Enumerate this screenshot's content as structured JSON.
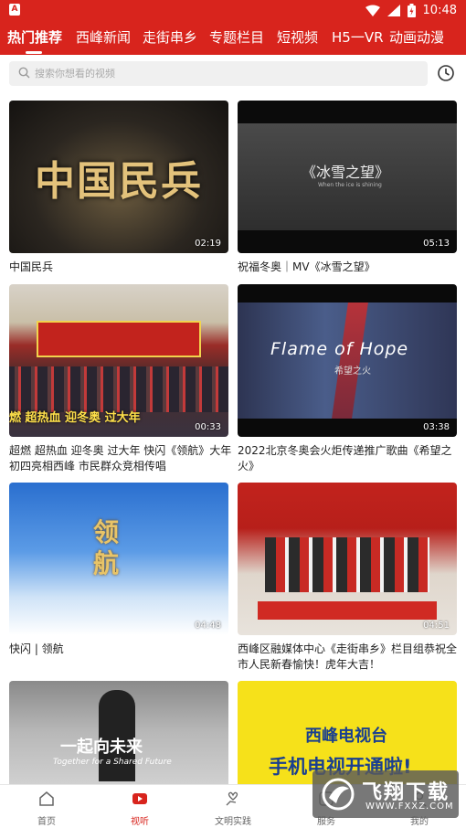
{
  "status": {
    "app_badge": "A",
    "time": "10:48"
  },
  "tabs": [
    {
      "label": "热门推荐",
      "active": true
    },
    {
      "label": "西峰新闻"
    },
    {
      "label": "走街串乡"
    },
    {
      "label": "专题栏目"
    },
    {
      "label": "短视频"
    },
    {
      "label": "H5一VR"
    },
    {
      "label": "动画动漫"
    }
  ],
  "search": {
    "placeholder": "搜索你想看的视频"
  },
  "thumb_text": {
    "v1_big": "中国民兵",
    "v2_title": "《冰雪之望》",
    "v2_sub": "When the ice is shining",
    "v3_banner": "燃 超热血 迎冬奥 过大年",
    "v4_title": "Flame of Hope",
    "v4_sub": "希望之火",
    "v5_title": "领航",
    "v7_cn": "一起向未来",
    "v7_en": "Together for a Shared Future",
    "v8_line1": "西峰电视台",
    "v8_line2": "手机电视开通啦!"
  },
  "videos": [
    {
      "title": "中国民兵",
      "duration": "02:19"
    },
    {
      "title": "祝福冬奥｜MV《冰雪之望》",
      "duration": "05:13"
    },
    {
      "title": "超燃  超热血  迎冬奥  过大年  快闪《领航》大年初四亮相西峰  市民群众竞相传唱",
      "duration": "00:33"
    },
    {
      "title": "2022北京冬奥会火炬传递推广歌曲《希望之火》",
      "duration": "03:38"
    },
    {
      "title": "快闪 | 领航",
      "duration": "04:48"
    },
    {
      "title": "西峰区融媒体中心《走街串乡》栏目组恭祝全市人民新春愉快！虎年大吉！",
      "duration": "04:51"
    },
    {
      "title": "",
      "duration": ""
    },
    {
      "title": "",
      "duration": ""
    }
  ],
  "bottom_nav": [
    {
      "label": "首页"
    },
    {
      "label": "视听",
      "active": true
    },
    {
      "label": "文明实践"
    },
    {
      "label": "服务"
    },
    {
      "label": "我的"
    }
  ],
  "watermark": {
    "brand": "飞翔下载",
    "url": "WWW.FXXZ.COM"
  },
  "colors": {
    "brand_red": "#d8241d",
    "bg": "#ffffff",
    "text": "#222222"
  }
}
